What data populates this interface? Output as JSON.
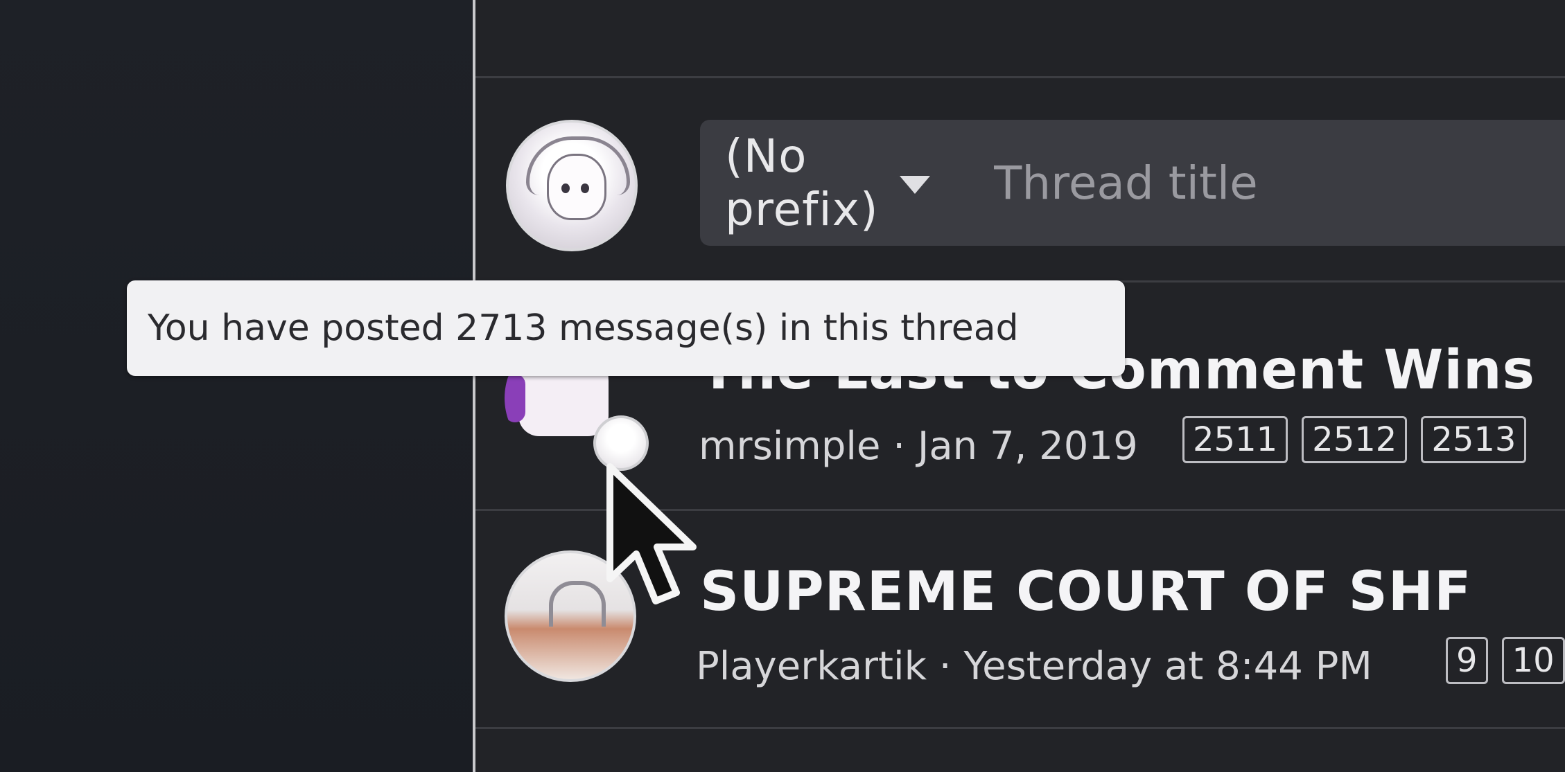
{
  "new_thread": {
    "prefix_label": "(No prefix)",
    "title_placeholder": "Thread title"
  },
  "tooltip": {
    "text": "You have posted 2713 message(s) in this thread"
  },
  "threads": [
    {
      "title": "The Last to Comment Wins",
      "author": "mrsimple",
      "date": "Jan 7, 2019",
      "meta": "mrsimple · Jan 7, 2019",
      "pages": [
        "2511",
        "2512",
        "2513"
      ]
    },
    {
      "title": "SUPREME COURT OF SHF",
      "author": "Playerkartik",
      "date": "Yesterday at 8:44 PM",
      "meta": "Playerkartik · Yesterday at 8:44 PM",
      "pages": [
        "9",
        "10"
      ]
    }
  ],
  "icons": [
    "user-avatar",
    "dropdown-caret-icon",
    "ghost-avatar",
    "participation-avatar-icon",
    "court-avatar",
    "mouse-pointer-icon"
  ]
}
